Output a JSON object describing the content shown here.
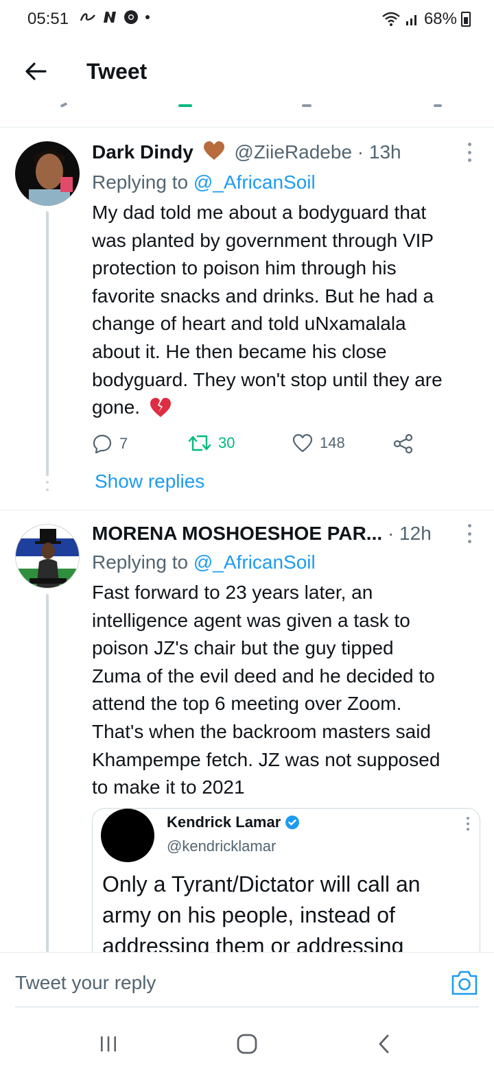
{
  "status_bar": {
    "time": "05:51",
    "battery": "68%"
  },
  "header": {
    "title": "Tweet"
  },
  "tweets": [
    {
      "name": "Dark Dindy",
      "handle": "@ZiieRadebe",
      "time": "13h",
      "replying_label": "Replying to",
      "replying_to": "@_AfricanSoil",
      "lines": [
        "My dad told me about a bodyguard that",
        "was planted by government through VIP",
        "protection to poison him through his",
        "favorite snacks and drinks. But he had a",
        "change of heart and told uNxamalala",
        "about it. He then became his close",
        "bodyguard. They won't stop until they are",
        "gone."
      ],
      "replies": "7",
      "retweets": "30",
      "likes": "148",
      "show_replies": "Show replies"
    },
    {
      "name": "MORENA MOSHOESHOE PAR...",
      "time": "12h",
      "replying_label": "Replying to",
      "replying_to": "@_AfricanSoil",
      "lines": [
        "Fast forward to 23 years later, an",
        "intelligence agent was given a task to",
        "poison JZ's chair but the guy tipped",
        "Zuma of the evil deed and he decided to",
        "attend the top 6 meeting over Zoom.",
        "That's when the backroom masters said",
        "Khampempe fetch. JZ was not supposed",
        "to make it to 2021"
      ],
      "embed": {
        "name": "Kendrick Lamar",
        "handle": "@kendricklamar",
        "lines": [
          "Only a Tyrant/Dictator will call an",
          "army on his people, instead of",
          "addressing them or addressing"
        ]
      }
    }
  ],
  "reply_bar": {
    "placeholder": "Tweet your reply"
  },
  "colors": {
    "accent": "#1d9bf0",
    "retweet": "#00ba7c",
    "secondary_text": "#536471"
  }
}
